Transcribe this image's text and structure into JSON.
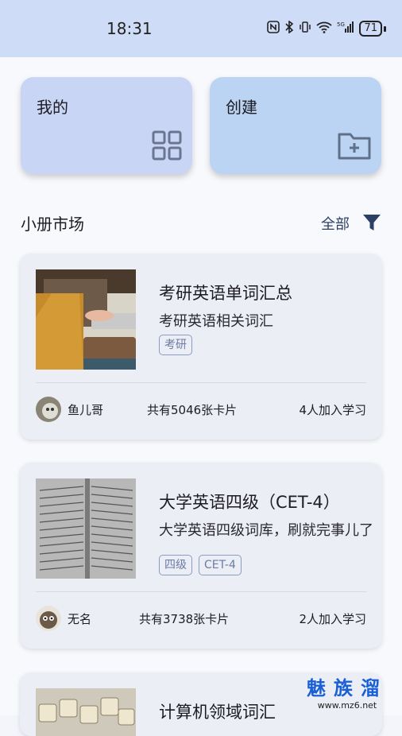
{
  "status": {
    "time": "18:31",
    "battery": "71",
    "network": "5G"
  },
  "tiles": {
    "mine": "我的",
    "create": "创建"
  },
  "section": {
    "title": "小册市场",
    "filter_label": "全部"
  },
  "books": [
    {
      "title": "考研英语单词汇总",
      "desc": "考研英语相关词汇",
      "tags": [
        "考研"
      ],
      "author": "鱼儿哥",
      "cards": "共有5046张卡片",
      "learners": "4人加入学习"
    },
    {
      "title": "大学英语四级（CET-4）",
      "desc": "大学英语四级词库，刷就完事儿了",
      "tags": [
        "四级",
        "CET-4"
      ],
      "author": "无名",
      "cards": "共有3738张卡片",
      "learners": "2人加入学习"
    },
    {
      "title": "计算机领域词汇"
    }
  ],
  "watermark": {
    "brand": "魅族溜",
    "url": "www.mz6.net"
  },
  "colors": {
    "status_bg": "#cfdcf7",
    "tile_mine": "#c9d5f5",
    "tile_create": "#bcd4f3",
    "accent": "#2e3f66"
  }
}
